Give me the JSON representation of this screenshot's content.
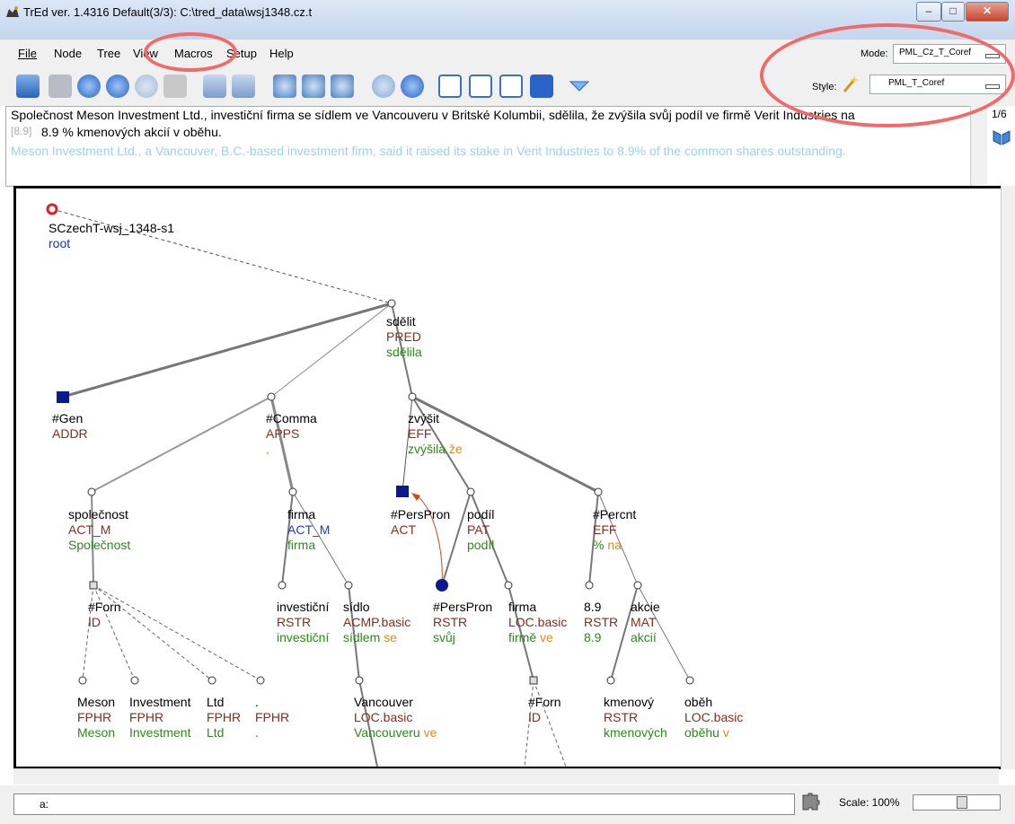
{
  "window": {
    "title": "TrEd ver. 1.4316   Default(3/3): C:\\tred_data\\wsj1348.cz.t",
    "minimize": "–",
    "maximize": "□",
    "close": "✕"
  },
  "menu": [
    "File",
    "Node",
    "Tree",
    "View",
    "Macros",
    "Setup",
    "Help"
  ],
  "mode": {
    "label": "Mode:",
    "value": "PML_Cz_T_Coref"
  },
  "style": {
    "label": "Style:",
    "value": "PML_T_Coref"
  },
  "sentence": {
    "line1": "Společnost Meson Investment Ltd., investiční firma se sídlem ve Vancouveru v Britské Kolumbii, sdělila, že zvýšila svůj podíl ve firmě Verit Industries na",
    "line2_prefix": "[8.9]",
    "line2": "8.9 % kmenových akcií v oběhu.",
    "english": "Meson Investment Ltd., a Vancouver, B.C.-based investment firm, said it raised its stake in Verit Industries to 8.9% of the common shares outstanding.",
    "counter": "1/6"
  },
  "tree": {
    "root": {
      "id": "SCzechT-wsj_1348-s1",
      "label": "root"
    },
    "nodes": [
      {
        "key": "sdelit",
        "lemma": "sdělit",
        "func": "PRED",
        "form": "sdělila"
      },
      {
        "key": "gen",
        "lemma": "#Gen",
        "func": "ADDR"
      },
      {
        "key": "comma",
        "lemma": "#Comma",
        "func": "APPS",
        "form": ","
      },
      {
        "key": "zvysit",
        "lemma": "zvýšit",
        "func": "EFF",
        "form": "zvýšila",
        "aux": "že"
      },
      {
        "key": "spolecnost",
        "lemma": "společnost",
        "func": "ACT_M",
        "form": "Společnost"
      },
      {
        "key": "firma1",
        "lemma": "firma",
        "func": "ACT_M",
        "form": "firma"
      },
      {
        "key": "perspron1",
        "lemma": "#PersPron",
        "func": "ACT"
      },
      {
        "key": "podil",
        "lemma": "podíl",
        "func": "PAT",
        "form": "podíl"
      },
      {
        "key": "percnt",
        "lemma": "#Percnt",
        "func": "EFF",
        "form": "%",
        "aux": "na"
      },
      {
        "key": "forn1",
        "lemma": "#Forn",
        "func": "ID"
      },
      {
        "key": "investicni",
        "lemma": "investiční",
        "func": "RSTR",
        "form": "investiční"
      },
      {
        "key": "sidlo",
        "lemma": "sídlo",
        "func": "ACMP.basic",
        "form": "sídlem",
        "aux": "se"
      },
      {
        "key": "perspron2",
        "lemma": "#PersPron",
        "func": "RSTR",
        "form": "svůj"
      },
      {
        "key": "firma2",
        "lemma": "firma",
        "func": "LOC.basic",
        "form": "firmě",
        "aux": "ve"
      },
      {
        "key": "n89",
        "lemma": "8.9",
        "func": "RSTR",
        "form": "8.9"
      },
      {
        "key": "akcie",
        "lemma": "akcie",
        "func": "MAT",
        "form": "akcií"
      },
      {
        "key": "meson",
        "lemma": "Meson",
        "func": "FPHR",
        "form": "Meson"
      },
      {
        "key": "investment",
        "lemma": "Investment",
        "func": "FPHR",
        "form": "Investment"
      },
      {
        "key": "ltd",
        "lemma": "Ltd",
        "func": "FPHR",
        "form": "Ltd"
      },
      {
        "key": "dot",
        "lemma": ".",
        "func": "FPHR",
        "form": "."
      },
      {
        "key": "vancouver",
        "lemma": "Vancouver",
        "func": "LOC.basic",
        "form": "Vancouveru",
        "aux": "ve"
      },
      {
        "key": "forn2",
        "lemma": "#Forn",
        "func": "ID"
      },
      {
        "key": "kmenovy",
        "lemma": "kmenový",
        "func": "RSTR",
        "form": "kmenových"
      },
      {
        "key": "obeh",
        "lemma": "oběh",
        "func": "LOC.basic",
        "form": "oběhu",
        "aux": "v"
      }
    ]
  },
  "status": {
    "input": "a:",
    "scale": "Scale: 100%"
  }
}
